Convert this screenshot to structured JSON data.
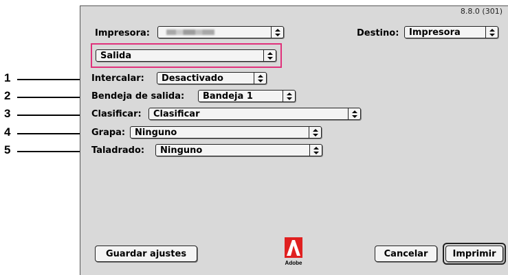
{
  "version": "8.8.0 (301)",
  "printer": {
    "label": "Impresora:",
    "value": ""
  },
  "destination": {
    "label": "Destino:",
    "value": "Impresora"
  },
  "panel": {
    "value": "Salida"
  },
  "fields": {
    "collate": {
      "number": "1",
      "label": "Intercalar:",
      "value": "Desactivado"
    },
    "output_tray": {
      "number": "2",
      "label": "Bendeja de salida:",
      "value": "Bandeja 1"
    },
    "sort": {
      "number": "3",
      "label": "Clasificar:",
      "value": "Clasificar"
    },
    "staple": {
      "number": "4",
      "label": "Grapa:",
      "value": "Ninguno"
    },
    "punch": {
      "number": "5",
      "label": "Taladrado:",
      "value": "Ninguno"
    }
  },
  "buttons": {
    "save": "Guardar ajustes",
    "cancel": "Cancelar",
    "print": "Imprimir"
  },
  "logo": {
    "text": "Adobe",
    "color": "#e02020"
  },
  "colors": {
    "highlight": "#e0307a",
    "dialog_bg": "#d9d9d9"
  }
}
